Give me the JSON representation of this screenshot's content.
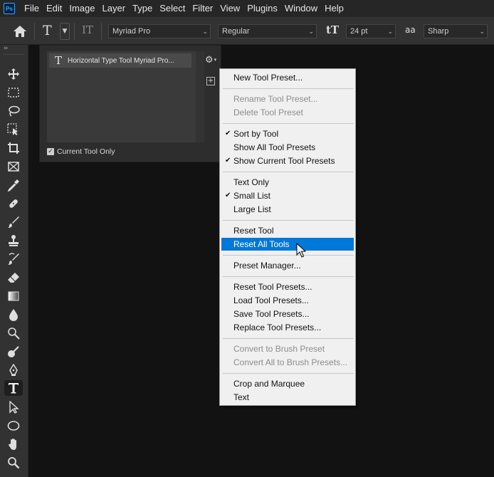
{
  "menubar": {
    "logo": "Ps",
    "items": [
      "File",
      "Edit",
      "Image",
      "Layer",
      "Type",
      "Select",
      "Filter",
      "View",
      "Plugins",
      "Window",
      "Help"
    ]
  },
  "options": {
    "tool_glyph": "T",
    "orient_glyph": "IT",
    "font_family": "Myriad Pro",
    "font_style": "Regular",
    "size_glyph": "tT",
    "font_size": "24 pt",
    "aa_glyph": "aa",
    "antialias": "Sharp"
  },
  "toolbar": {
    "collapse": "››",
    "tools": [
      {
        "name": "move-tool-icon"
      },
      {
        "name": "marquee-tool-icon"
      },
      {
        "name": "lasso-tool-icon"
      },
      {
        "name": "object-select-tool-icon"
      },
      {
        "name": "crop-tool-icon"
      },
      {
        "name": "frame-tool-icon"
      },
      {
        "name": "eyedropper-tool-icon"
      },
      {
        "name": "healing-brush-tool-icon"
      },
      {
        "name": "brush-tool-icon"
      },
      {
        "name": "clone-stamp-tool-icon"
      },
      {
        "name": "history-brush-tool-icon"
      },
      {
        "name": "eraser-tool-icon"
      },
      {
        "name": "gradient-tool-icon"
      },
      {
        "name": "blur-tool-icon"
      },
      {
        "name": "dodge-tool-icon"
      },
      {
        "name": "smudge-tool-icon"
      },
      {
        "name": "pen-tool-icon"
      },
      {
        "name": "type-tool-icon"
      },
      {
        "name": "path-select-tool-icon"
      },
      {
        "name": "ellipse-tool-icon"
      },
      {
        "name": "hand-tool-icon"
      },
      {
        "name": "zoom-tool-icon"
      }
    ]
  },
  "panel": {
    "preset_icon": "T",
    "preset_label": "Horizontal Type Tool Myriad Pro...",
    "gear": "⚙",
    "new_btn": "+",
    "checkbox_label": "Current Tool Only",
    "checkbox_checked": true,
    "check_mark": "✓"
  },
  "menu": {
    "tick": "✔",
    "items": {
      "new_preset": "New Tool Preset...",
      "rename_preset": "Rename Tool Preset...",
      "delete_preset": "Delete Tool Preset",
      "sort_by_tool": "Sort by Tool",
      "show_all": "Show All Tool Presets",
      "show_current": "Show Current Tool Presets",
      "text_only": "Text Only",
      "small_list": "Small List",
      "large_list": "Large List",
      "reset_tool": "Reset Tool",
      "reset_all_tools": "Reset All Tools",
      "preset_manager": "Preset Manager...",
      "reset_presets": "Reset Tool Presets...",
      "load_presets": "Load Tool Presets...",
      "save_presets": "Save Tool Presets...",
      "replace_presets": "Replace Tool Presets...",
      "convert_brush": "Convert to Brush Preset",
      "convert_all_brush": "Convert All to Brush Presets...",
      "crop_marquee": "Crop and Marquee",
      "text": "Text"
    }
  }
}
